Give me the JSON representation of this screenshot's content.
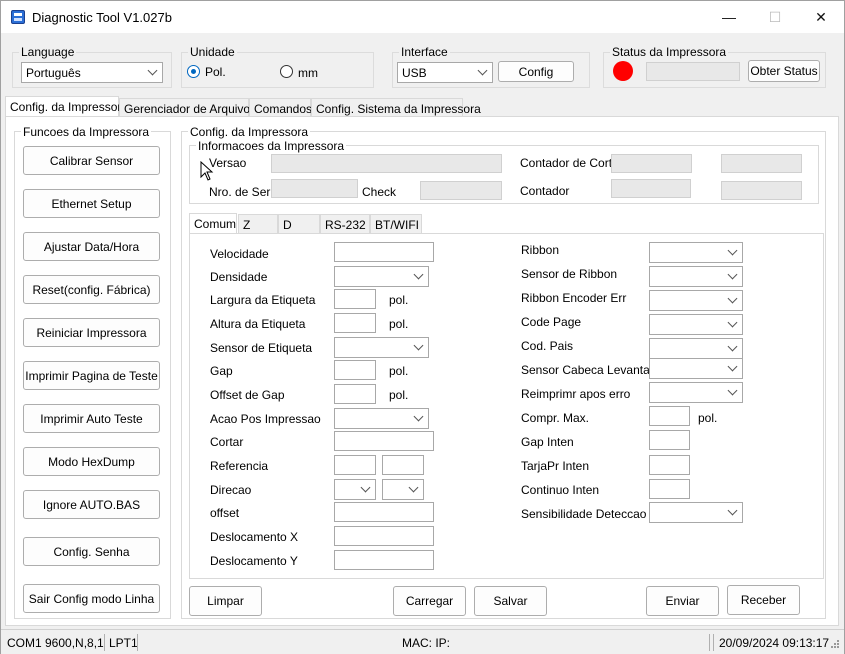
{
  "window": {
    "title": "Diagnostic Tool V1.027b",
    "minimize": "—",
    "maximize": "☐",
    "close": "✕"
  },
  "language": {
    "label": "Language",
    "value": "Português"
  },
  "unidade": {
    "label": "Unidade",
    "opt_pol": "Pol.",
    "opt_mm": "mm"
  },
  "interface": {
    "label": "Interface",
    "value": "USB",
    "config_button": "Config"
  },
  "status": {
    "label": "Status da Impressora",
    "button": "Obter Status",
    "color": "#ff0000"
  },
  "main_tabs": [
    "Config. da Impressora",
    "Gerenciador de Arquivos",
    "Comandos",
    "Config. Sistema da Impressora"
  ],
  "functions": {
    "label": "Funcoes da Impressora",
    "buttons": [
      "Calibrar Sensor",
      "Ethernet Setup",
      "Ajustar Data/Hora",
      "Reset(config. Fábrica)",
      "Reiniciar  Impressora",
      "Imprimir Pagina de Teste",
      "Imprimir Auto Teste",
      "Modo HexDump",
      "Ignore AUTO.BAS",
      "Config. Senha",
      "Sair Config modo Linha"
    ]
  },
  "config": {
    "label": "Config. da Impressora",
    "info_label": "Informacoes da Impressora",
    "versao": "Versao",
    "nro_serie": "Nro. de Serie",
    "check": "Check",
    "contador_cortes": "Contador de Cortes",
    "contador": "Contador"
  },
  "sub_tabs": [
    "Comum",
    "Z",
    "D",
    "RS-232",
    "BT/WIFI"
  ],
  "left_fields": {
    "velocidade": "Velocidade",
    "densidade": "Densidade",
    "largura": "Largura da Etiqueta",
    "altura": "Altura da Etiqueta",
    "sensor": "Sensor de Etiqueta",
    "gap": "Gap",
    "offset_gap": "Offset de Gap",
    "acao": "Acao Pos Impressao",
    "cortar": "Cortar",
    "referencia": "Referencia",
    "direcao": "Direcao",
    "offset": "offset",
    "desl_x": "Deslocamento X",
    "desl_y": "Deslocamento Y",
    "unit": "pol."
  },
  "right_fields": {
    "ribbon": "Ribbon",
    "sensor_ribbon": "Sensor de Ribbon",
    "ribbon_encoder": "Ribbon Encoder Err",
    "code_page": "Code Page",
    "cod_pais": "Cod. Pais",
    "sensor_cabeca": "Sensor Cabeca Levantada",
    "reimprimir": "Reimprimr apos erro",
    "compr_max": "Compr. Max.",
    "gap_inten": "Gap Inten",
    "tarjapr": "TarjaPr Inten",
    "continuo": "Continuo Inten",
    "sensibilidade": "Sensibilidade Deteccao",
    "unit": "pol."
  },
  "actions": {
    "limpar": "Limpar",
    "carregar": "Carregar",
    "salvar": "Salvar",
    "enviar": "Enviar",
    "receber": "Receber"
  },
  "statusbar": {
    "com": "COM1 9600,N,8,1",
    "lpt": "LPT1",
    "mac": "MAC: IP:",
    "datetime": "20/09/2024 09:13:17"
  }
}
